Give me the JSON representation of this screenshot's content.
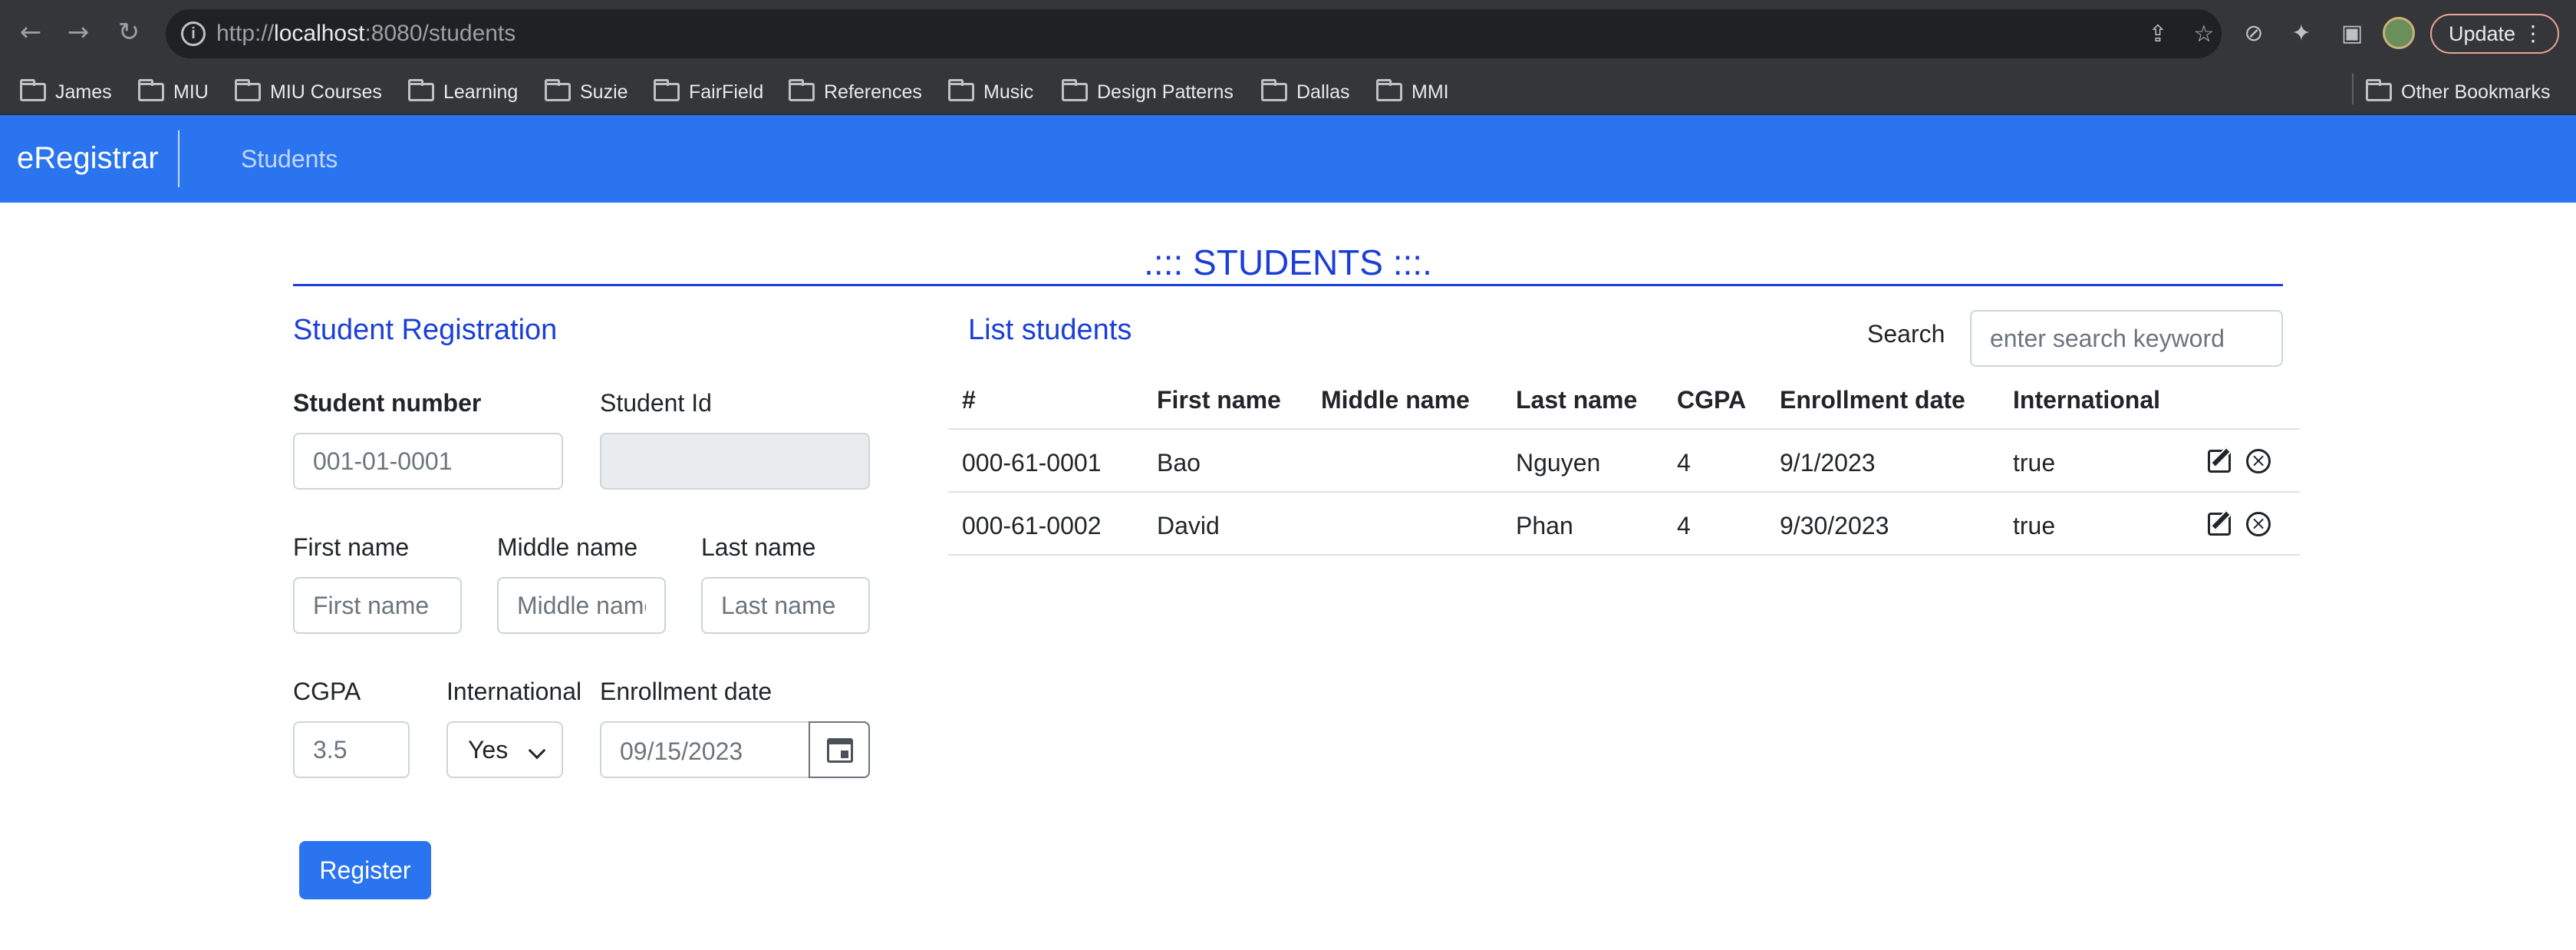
{
  "browser": {
    "url_prefix": "http://",
    "url_host": "localhost",
    "url_rest": ":8080/students",
    "update_label": "Update",
    "bookmarks": [
      "James",
      "MIU",
      "MIU Courses",
      "Learning",
      "Suzie",
      "FairField",
      "References",
      "Music",
      "Design Patterns",
      "Dallas",
      "MMI"
    ],
    "other_bookmarks": "Other Bookmarks"
  },
  "navbar": {
    "brand": "eRegistrar",
    "link_students": "Students"
  },
  "page": {
    "title": ".::: STUDENTS :::."
  },
  "registration": {
    "title": "Student Registration",
    "student_number_label": "Student number",
    "student_number_placeholder": "001-01-0001",
    "student_id_label": "Student Id",
    "first_name_label": "First name",
    "first_name_placeholder": "First name",
    "middle_name_label": "Middle name",
    "middle_name_placeholder": "Middle name",
    "last_name_label": "Last name",
    "last_name_placeholder": "Last name",
    "cgpa_label": "CGPA",
    "cgpa_placeholder": "3.5",
    "international_label": "International",
    "international_value": "Yes",
    "enrollment_label": "Enrollment date",
    "enrollment_value": "09/15/2023",
    "register_button": "Register"
  },
  "list": {
    "title": "List students",
    "search_label": "Search",
    "search_placeholder": "enter search keyword",
    "columns": [
      "#",
      "First name",
      "Middle name",
      "Last name",
      "CGPA",
      "Enrollment date",
      "International"
    ],
    "rows": [
      {
        "number": "000-61-0001",
        "first": "Bao",
        "middle": "",
        "last": "Nguyen",
        "cgpa": "4",
        "enrollment": "9/1/2023",
        "international": "true"
      },
      {
        "number": "000-61-0002",
        "first": "David",
        "middle": "",
        "last": "Phan",
        "cgpa": "4",
        "enrollment": "9/30/2023",
        "international": "true"
      }
    ]
  },
  "colors": {
    "navbar": "#2b74f0",
    "heading": "#1a3fd9",
    "button": "#2b74f0"
  }
}
